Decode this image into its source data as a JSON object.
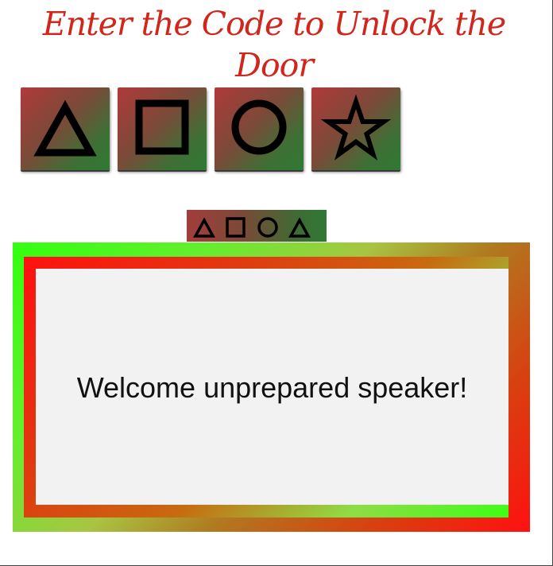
{
  "title": "Enter the Code to Unlock the Door",
  "keypad": {
    "keys": [
      {
        "name": "triangle-key",
        "icon": "triangle-icon"
      },
      {
        "name": "square-key",
        "icon": "square-icon"
      },
      {
        "name": "circle-key",
        "icon": "circle-icon"
      },
      {
        "name": "star-key",
        "icon": "star-icon"
      }
    ]
  },
  "code_display": {
    "entered_sequence": [
      "triangle-icon",
      "square-icon",
      "circle-icon",
      "triangle-icon"
    ]
  },
  "screen": {
    "message": "Welcome unprepared speaker!"
  },
  "colors": {
    "title": "#d0261c",
    "key_gradient_start": "#b03a3a",
    "key_gradient_end": "#2f7a34",
    "screen_background": "#f2f2f2",
    "frame_green": "#32ff10",
    "frame_red": "#ff1010"
  }
}
